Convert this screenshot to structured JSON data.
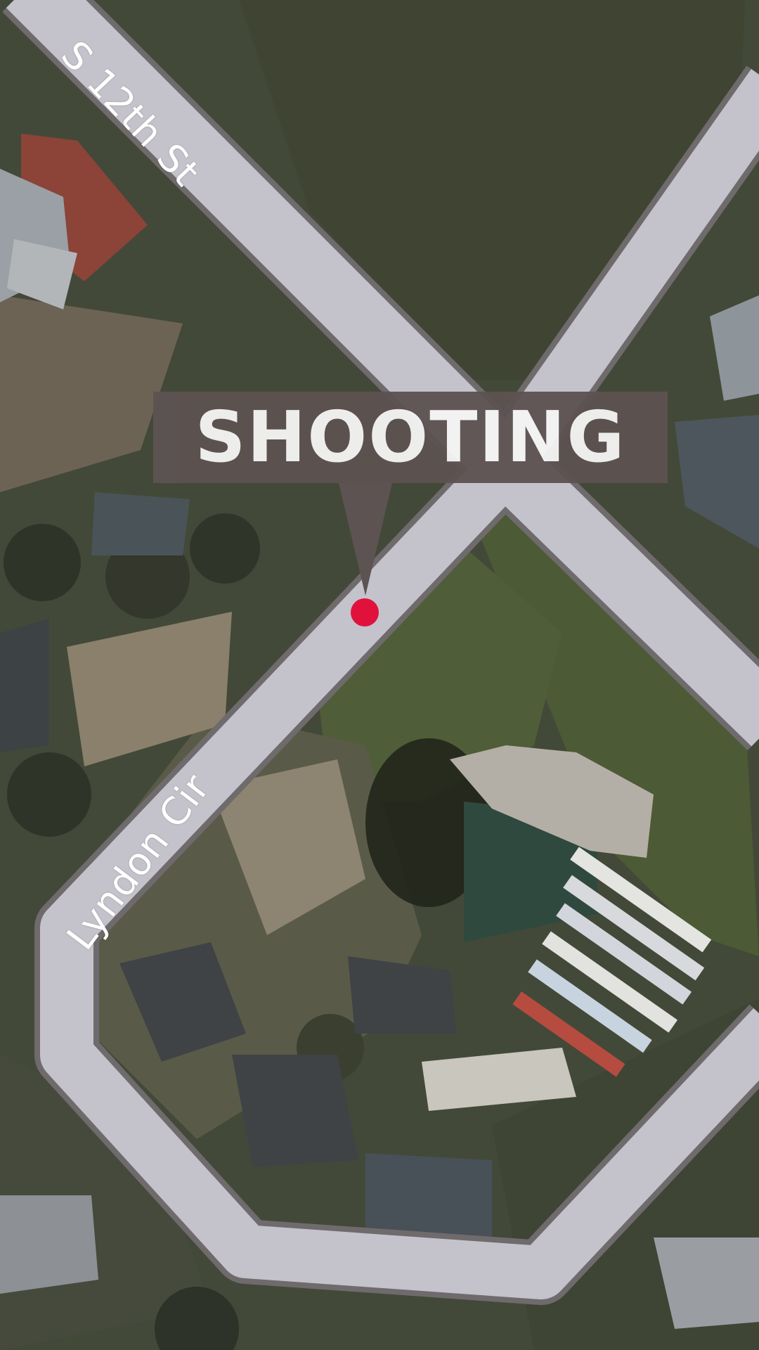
{
  "map": {
    "view": "satellite",
    "streets": {
      "s12th": "S 12th St",
      "lyndon": "Lyndon Cir"
    },
    "callout": {
      "text": "SHOOTING"
    },
    "marker": {
      "icon": "location-dot-icon"
    },
    "colors": {
      "road": "#c3c3cb",
      "road_edge": "#6f6a6c",
      "callout_bg": "#5d5352",
      "callout_text": "#f4f4f4",
      "marker": "#e0123c"
    }
  }
}
